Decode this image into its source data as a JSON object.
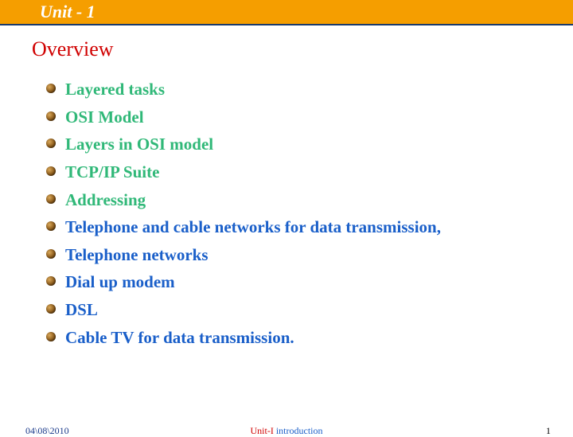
{
  "header": {
    "title": "Unit - 1"
  },
  "main": {
    "heading": "Overview",
    "topics": [
      {
        "text": "Layered tasks",
        "style": "green"
      },
      {
        "text": "OSI Model",
        "style": "green"
      },
      {
        "text": "Layers in OSI model",
        "style": "green"
      },
      {
        "text": "TCP/IP Suite",
        "style": "green"
      },
      {
        "text": "Addressing",
        "style": "green"
      },
      {
        "text": "Telephone and cable networks for data transmission,",
        "style": "blue"
      },
      {
        "text": "Telephone networks",
        "style": "blue"
      },
      {
        "text": "Dial up modem",
        "style": "blue"
      },
      {
        "text": "DSL",
        "style": "blue"
      },
      {
        "text": "Cable TV for data transmission.",
        "style": "blue"
      }
    ]
  },
  "footer": {
    "date": "04\\08\\2010",
    "center_unit": "Unit-I",
    "center_intro": " introduction",
    "page": "1"
  }
}
